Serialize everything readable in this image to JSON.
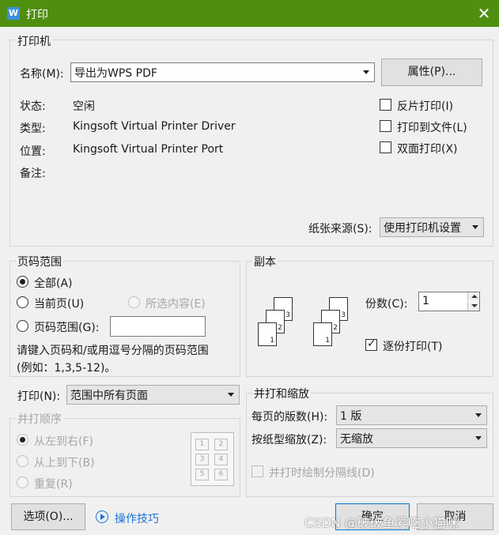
{
  "window": {
    "title": "打印",
    "logo_letter": "W"
  },
  "printer": {
    "group_label": "打印机",
    "name_label": "名称(M):",
    "name_value": "导出为WPS PDF",
    "properties_button": "属性(P)...",
    "status_label": "状态:",
    "status_value": "空闲",
    "type_label": "类型:",
    "type_value": "Kingsoft Virtual Printer Driver",
    "location_label": "位置:",
    "location_value": "Kingsoft Virtual Printer Port",
    "comment_label": "备注:",
    "reverse_print": "反片打印(I)",
    "print_to_file": "打印到文件(L)",
    "duplex": "双面打印(X)",
    "paper_source_label": "纸张来源(S):",
    "paper_source_value": "使用打印机设置"
  },
  "page_range": {
    "group_label": "页码范围",
    "all": "全部(A)",
    "current": "当前页(U)",
    "selection": "所选内容(E)",
    "pages": "页码范围(G):",
    "hint_line1": "请键入页码和/或用逗号分隔的页码范围",
    "hint_line2": "(例如：1,3,5-12)。"
  },
  "print_what": {
    "label": "打印(N):",
    "value": "范围中所有页面"
  },
  "collate_order": {
    "group_label": "并打顺序",
    "left_to_right": "从左到右(F)",
    "top_to_bottom": "从上到下(B)",
    "repeat": "重复(R)",
    "grid": [
      "1",
      "2",
      "3",
      "4",
      "5",
      "6"
    ]
  },
  "copies": {
    "group_label": "副本",
    "count_label": "份数(C):",
    "count_value": "1",
    "collate": "逐份打印(T)",
    "stack_pages": [
      "3",
      "2",
      "1"
    ]
  },
  "zoom": {
    "group_label": "并打和缩放",
    "pages_per_sheet_label": "每页的版数(H):",
    "pages_per_sheet_value": "1 版",
    "scale_label": "按纸型缩放(Z):",
    "scale_value": "无缩放",
    "draw_separator": "并打时绘制分隔线(D)"
  },
  "footer": {
    "options_button": "选项(O)...",
    "tips_link": "操作技巧",
    "ok_button": "确定",
    "cancel_button": "取消"
  },
  "watermark": "CSDN @破破鱼爱吃小猫咪"
}
